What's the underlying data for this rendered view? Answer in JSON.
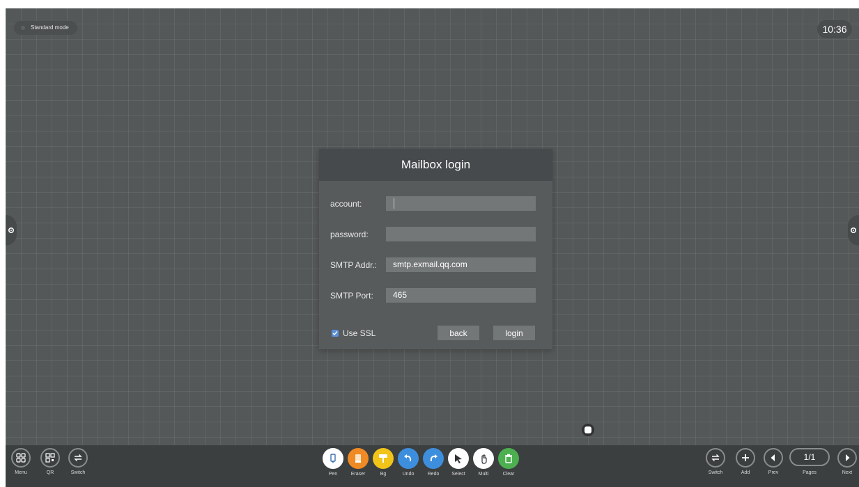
{
  "status": {
    "mode_label": "Standard mode",
    "clock": "10:36"
  },
  "dialog": {
    "title": "Mailbox login",
    "fields": [
      {
        "label": "account:",
        "value": ""
      },
      {
        "label": "password:",
        "value": ""
      },
      {
        "label": "SMTP Addr.:",
        "value": "smtp.exmail.qq.com"
      },
      {
        "label": "SMTP Port:",
        "value": "465"
      }
    ],
    "use_ssl": {
      "label": "Use SSL",
      "checked": true
    },
    "back_label": "back",
    "login_label": "login"
  },
  "toolbar": {
    "left": [
      {
        "icon": "menu-grid-icon",
        "label": "Menu"
      },
      {
        "icon": "qr-code-icon",
        "label": "QR"
      },
      {
        "icon": "switch-icon",
        "label": "Switch"
      }
    ],
    "tools": [
      {
        "icon": "pen-icon",
        "label": "Pen",
        "color": "#ffffff"
      },
      {
        "icon": "eraser-icon",
        "label": "Eraser",
        "color": "#f08a24"
      },
      {
        "icon": "brush-icon",
        "label": "Bg",
        "color": "#f0c419"
      },
      {
        "icon": "undo-icon",
        "label": "Undo",
        "color": "#3e8ede"
      },
      {
        "icon": "redo-icon",
        "label": "Redo",
        "color": "#3e8ede"
      },
      {
        "icon": "select-arrow-icon",
        "label": "Select",
        "color": "#4b4e50"
      },
      {
        "icon": "multi-touch-icon",
        "label": "Multi",
        "color": "#4b4e50"
      },
      {
        "icon": "trash-icon",
        "label": "Clear",
        "color": "#4caf50"
      }
    ],
    "right": [
      {
        "icon": "switch-icon",
        "label": "Switch"
      },
      {
        "icon": "add-icon",
        "label": "Add"
      },
      {
        "icon": "prev-icon",
        "label": "Prev"
      },
      {
        "icon": "pages-indicator",
        "label": "Pages",
        "value": "1/1"
      },
      {
        "icon": "next-icon",
        "label": "Next"
      }
    ]
  }
}
